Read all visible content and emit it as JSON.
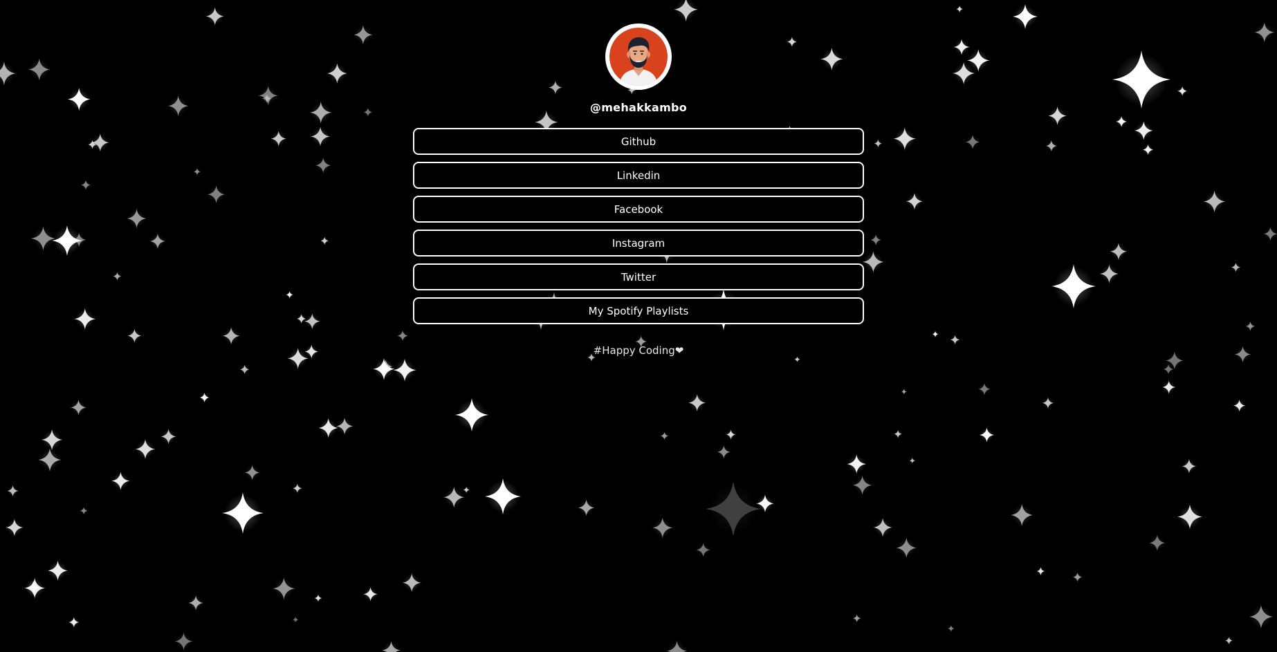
{
  "profile": {
    "username": "@mehakkambo"
  },
  "links": [
    {
      "label": "Github"
    },
    {
      "label": "Linkedin"
    },
    {
      "label": "Facebook"
    },
    {
      "label": "Instagram"
    },
    {
      "label": "Twitter"
    },
    {
      "label": "My Spotify Playlists"
    }
  ],
  "footer": {
    "text": "#Happy Coding❤"
  },
  "colors": {
    "background": "#000000",
    "foreground": "#ffffff",
    "avatar_background": "#d8431e"
  },
  "icons": {
    "avatar": "person-avatar-illustration",
    "background_decoration": "sparkle-star"
  }
}
